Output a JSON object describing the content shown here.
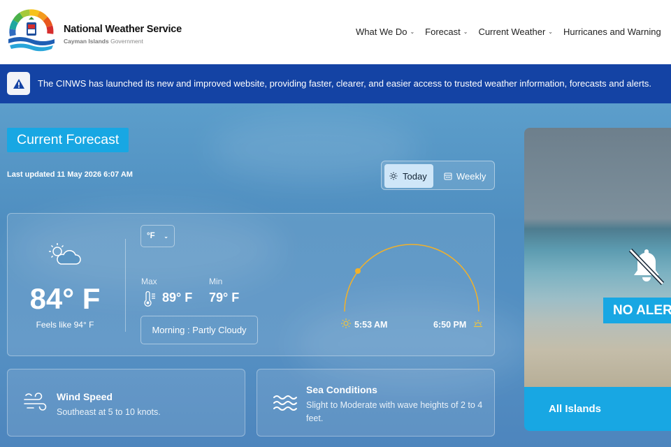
{
  "header": {
    "org_name": "National Weather Service",
    "org_sub_bold": "Cayman Islands",
    "org_sub_rest": " Government",
    "nav": [
      {
        "label": "What We Do"
      },
      {
        "label": "Forecast"
      },
      {
        "label": "Current Weather"
      },
      {
        "label": "Hurricanes and Warning"
      }
    ]
  },
  "banner": {
    "icon": "warning-icon",
    "text": "The CINWS has launched its new and improved website, providing faster, clearer, and easier access to trusted weather information, forecasts and alerts."
  },
  "forecast": {
    "title": "Current Forecast",
    "updated": "Last updated 11 May 2026 6:07 AM",
    "toggle": {
      "today": "Today",
      "weekly": "Weekly",
      "selected": "Today"
    },
    "condition_icon": "partly-cloudy-icon",
    "temp": "84° F",
    "feels_like": "Feels like 94° F",
    "unit": "°F",
    "max_label": "Max",
    "max_value": "89° F",
    "min_label": "Min",
    "min_value": "79° F",
    "condition": "Morning : Partly Cloudy",
    "sunrise": "5:53 AM",
    "sunset": "6:50 PM"
  },
  "wind": {
    "title": "Wind Speed",
    "desc": "Southeast at 5 to 10 knots."
  },
  "sea": {
    "title": "Sea Conditions",
    "desc": "Slight to Moderate with wave heights of 2 to 4 feet."
  },
  "alerts": {
    "status": "NO ALER",
    "region": "All Islands"
  },
  "colors": {
    "banner": "#1443a4",
    "accent": "#18a7e3",
    "sun_arc": "#f2b12a"
  }
}
